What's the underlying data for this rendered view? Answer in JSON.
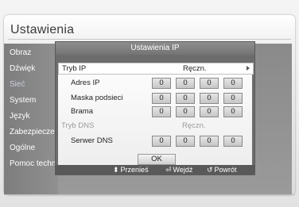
{
  "screen": {
    "title": "Ustawienia"
  },
  "sidebar": {
    "items": [
      {
        "label": "Obraz",
        "active": false
      },
      {
        "label": "Dźwięk",
        "active": false
      },
      {
        "label": "Sieć",
        "active": true
      },
      {
        "label": "System",
        "active": false
      },
      {
        "label": "Język",
        "active": false
      },
      {
        "label": "Zabezpieczenia",
        "active": false
      },
      {
        "label": "Ogólne",
        "active": false
      },
      {
        "label": "Pomoc techniczna",
        "active": false
      }
    ]
  },
  "dialog": {
    "title": "Ustawienia IP",
    "ip_mode": {
      "label": "Tryb IP",
      "value": "Ręczn."
    },
    "ip_address": {
      "label": "Adres IP",
      "octets": [
        "0",
        "0",
        "0",
        "0"
      ]
    },
    "subnet_mask": {
      "label": "Maska podsieci",
      "octets": [
        "0",
        "0",
        "0",
        "0"
      ]
    },
    "gateway": {
      "label": "Brama",
      "octets": [
        "0",
        "0",
        "0",
        "0"
      ]
    },
    "dns_mode": {
      "label": "Tryb DNS",
      "value": "Ręczn."
    },
    "dns_server": {
      "label": "Serwer DNS",
      "octets": [
        "0",
        "0",
        "0",
        "0"
      ]
    },
    "ok_label": "OK"
  },
  "hints": {
    "move": {
      "icon": "updown-arrows-icon",
      "label": "Przenieś"
    },
    "enter": {
      "icon": "enter-icon",
      "label": "Wejdź"
    },
    "back": {
      "icon": "return-icon",
      "label": "Powrót"
    }
  },
  "colors": {
    "sidebar_bg": "#858585",
    "dialog_bg": "#6c6c6c",
    "active_item": "#c8d2de"
  }
}
